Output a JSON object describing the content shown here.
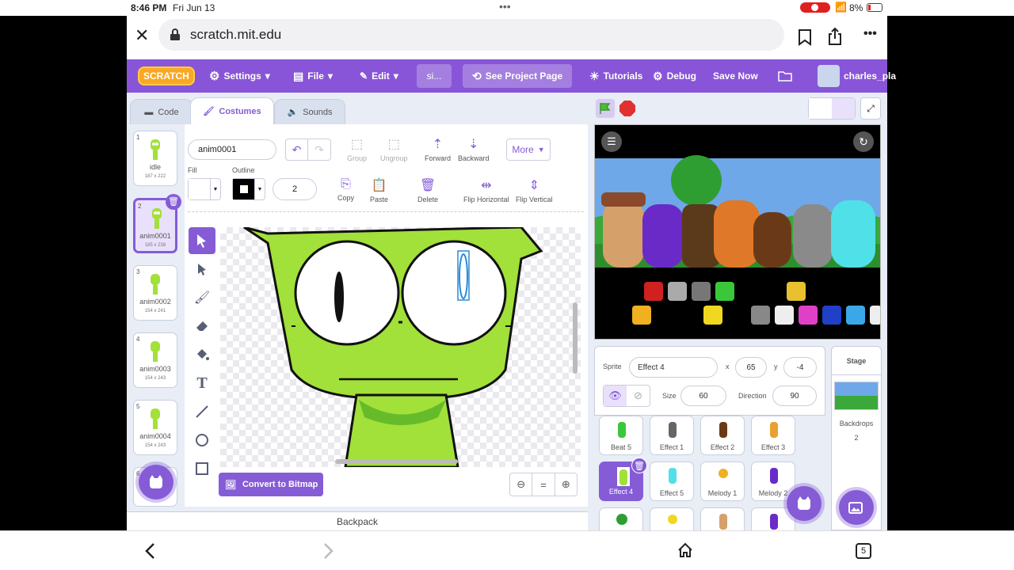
{
  "status": {
    "time": "8:46 PM",
    "date": "Fri Jun 13",
    "battery": "8%"
  },
  "browser": {
    "url": "scratch.mit.edu"
  },
  "menu": {
    "logo": "SCRATCH",
    "settings": "Settings",
    "file": "File",
    "edit": "Edit",
    "project_title": "si...",
    "see_project": "See Project Page",
    "tutorials": "Tutorials",
    "debug": "Debug",
    "save_now": "Save Now",
    "username": "charles_pla"
  },
  "tabs": {
    "code": "Code",
    "costumes": "Costumes",
    "sounds": "Sounds"
  },
  "costumes": [
    {
      "num": "1",
      "name": "idle",
      "size": "187 x 222"
    },
    {
      "num": "2",
      "name": "anim0001",
      "size": "185 x 238"
    },
    {
      "num": "3",
      "name": "anim0002",
      "size": "154 x 241"
    },
    {
      "num": "4",
      "name": "anim0003",
      "size": "154 x 243"
    },
    {
      "num": "5",
      "name": "anim0004",
      "size": "154 x 243"
    },
    {
      "num": "6"
    }
  ],
  "editor": {
    "costume_name": "anim0001",
    "group": "Group",
    "ungroup": "Ungroup",
    "forward": "Forward",
    "backward": "Backward",
    "more": "More",
    "fill": "Fill",
    "outline": "Outline",
    "outline_width": "2",
    "copy": "Copy",
    "paste": "Paste",
    "delete": "Delete",
    "flip_h": "Flip Horizontal",
    "flip_v": "Flip Vertical",
    "convert": "Convert to Bitmap",
    "zoom_reset": "="
  },
  "backpack": "Backpack",
  "sprite": {
    "label": "Sprite",
    "name": "Effect 4",
    "x_label": "x",
    "x": "65",
    "y_label": "y",
    "y": "-4",
    "size_label": "Size",
    "size": "60",
    "direction_label": "Direction",
    "direction": "90"
  },
  "sprites": [
    {
      "name": "Beat 5"
    },
    {
      "name": "Effect 1"
    },
    {
      "name": "Effect 2"
    },
    {
      "name": "Effect 3"
    },
    {
      "name": "Effect 4"
    },
    {
      "name": "Effect 5"
    },
    {
      "name": "Melody 1"
    },
    {
      "name": "Melody 2"
    }
  ],
  "stage_panel": {
    "title": "Stage",
    "backdrops_label": "Backdrops",
    "backdrops_count": "2"
  },
  "bottom": {
    "tabs_count": "5"
  },
  "colors": {
    "accent": "#855cd6",
    "menubar": "#8855d8",
    "character": "#a2e03a"
  }
}
